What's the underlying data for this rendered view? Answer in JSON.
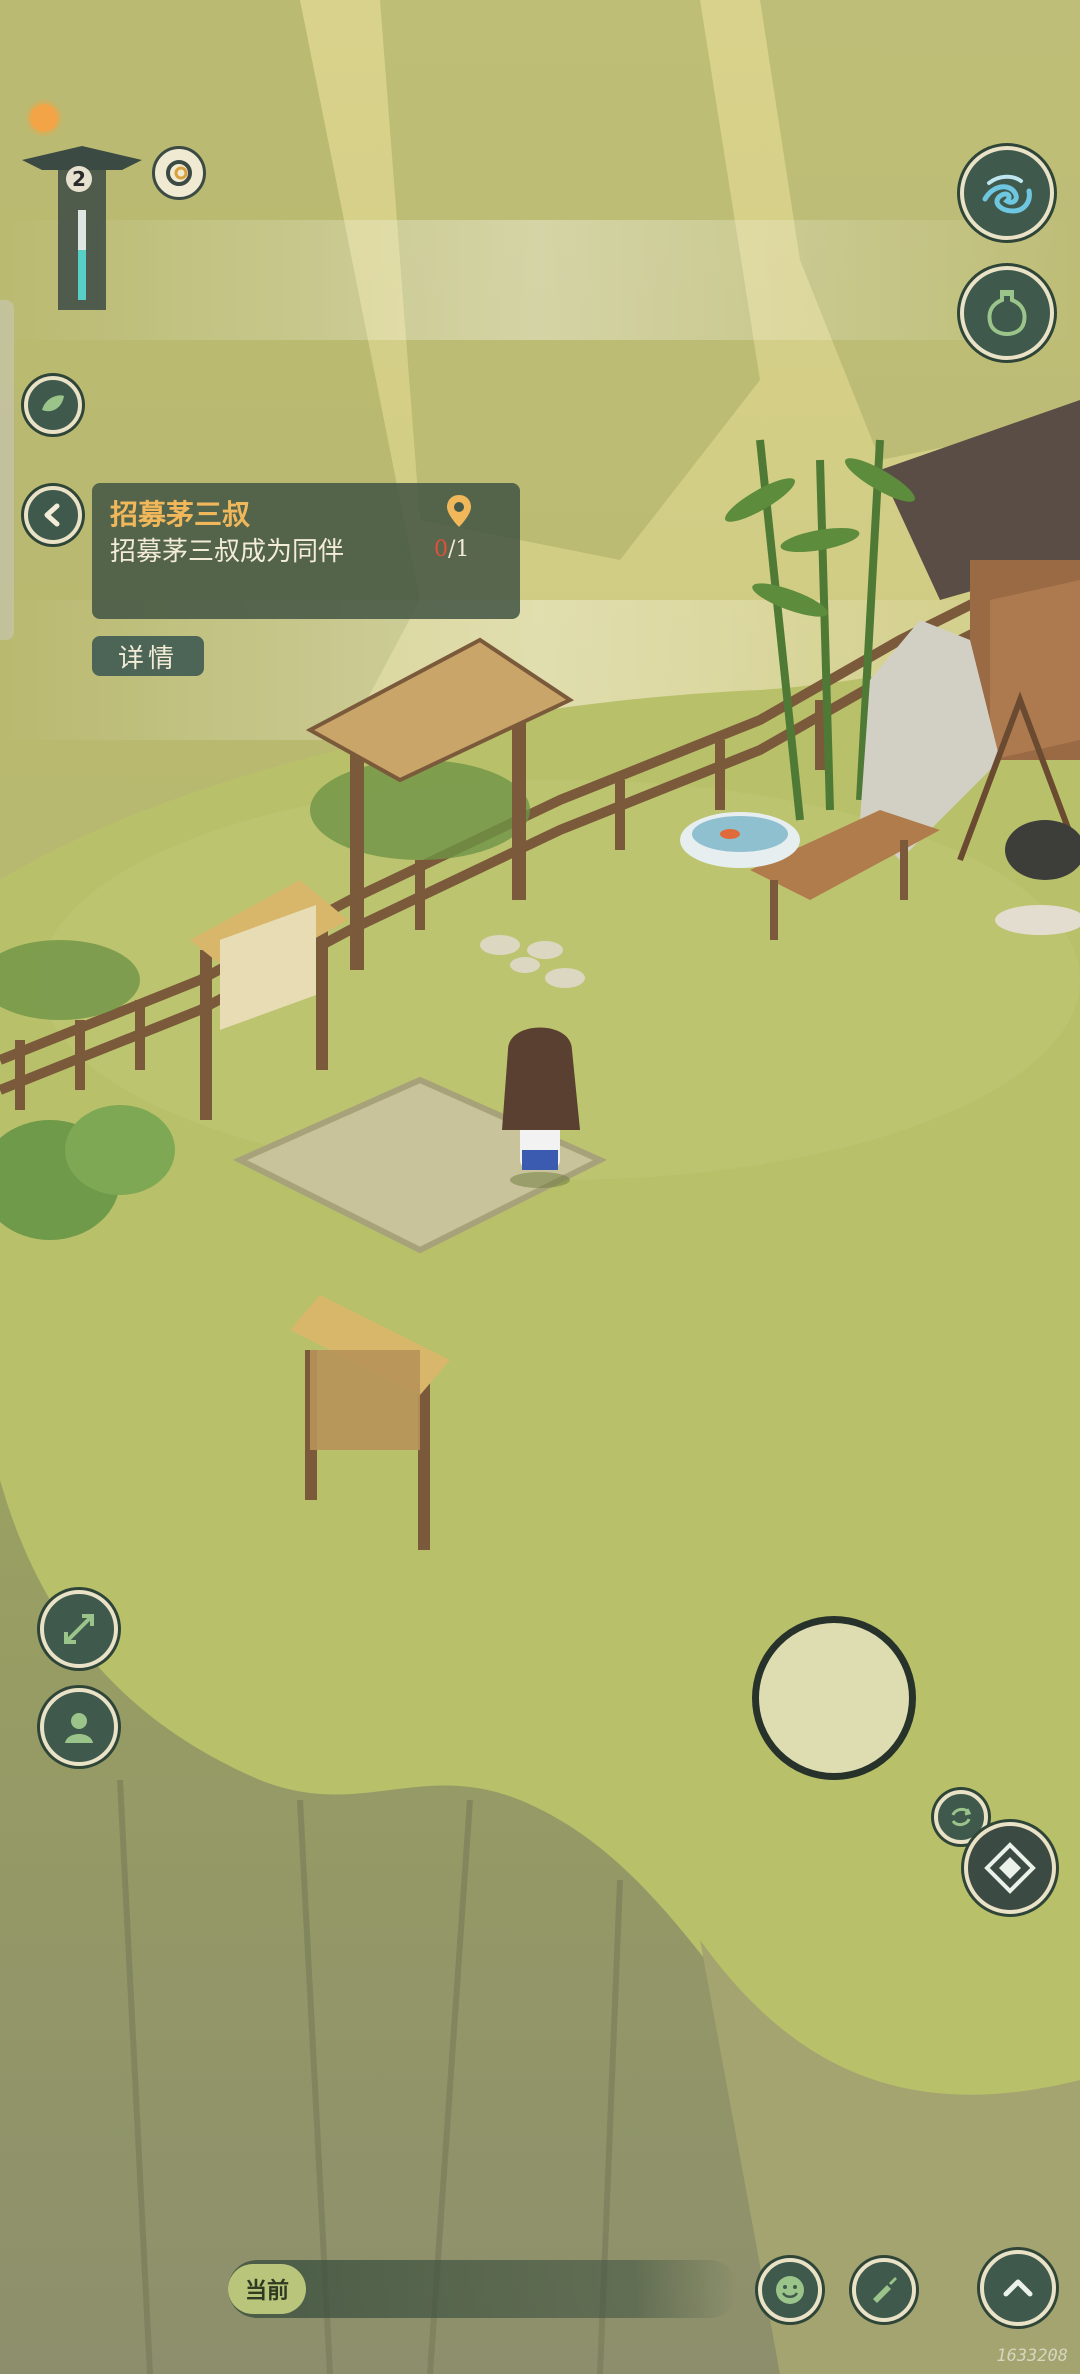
{
  "quest": {
    "title": "招募茅三叔",
    "description": "招募茅三叔成为同伴",
    "progress_current": "0",
    "progress_total": "/1",
    "details_label": "详情"
  },
  "hud": {
    "level": "2"
  },
  "chat": {
    "channel_label": "当前"
  },
  "build_id": "1633208",
  "colors": {
    "hud_fill": "#3f5a4c",
    "hud_ring": "#e9e2c6",
    "quest_title": "#f0b85b",
    "progress_current": "#e0503a",
    "grass": "#b9c06a"
  },
  "icons": {
    "sun": "sun-icon",
    "pagoda_gauge": "pagoda-gauge-icon",
    "swirl": "swirl-icon",
    "wave": "wave-icon",
    "gourd": "gourd-icon",
    "leaf": "leaf-icon",
    "back": "chevron-left-icon",
    "location": "location-pin-icon",
    "expand": "expand-icon",
    "companion": "companion-icon",
    "joystick": "joystick",
    "switch": "switch-icon",
    "attack": "diamond-attack-icon",
    "emote": "smile-icon",
    "brush": "brush-icon",
    "expand_up": "chevron-up-icon"
  }
}
